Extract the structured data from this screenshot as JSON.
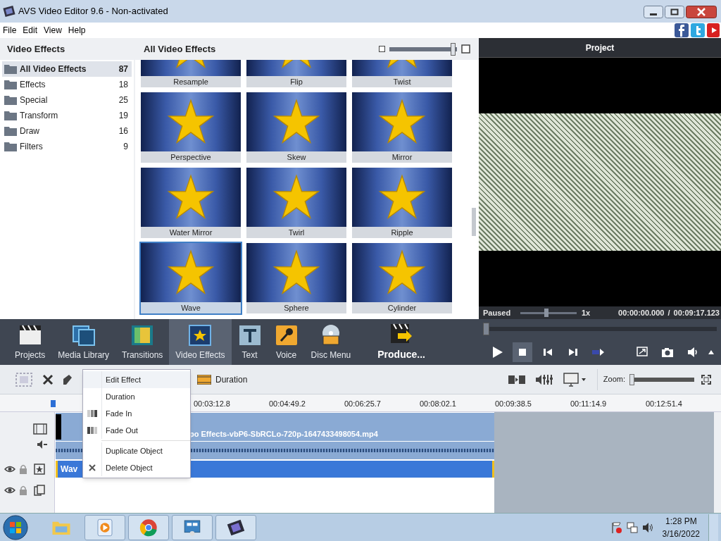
{
  "window": {
    "title": "AVS Video Editor 9.6 - Non-activated"
  },
  "menu": [
    "File",
    "Edit",
    "View",
    "Help"
  ],
  "categories_panel": {
    "title": "Video Effects",
    "items": [
      {
        "label": "All Video Effects",
        "count": "87",
        "selected": true
      },
      {
        "label": "Effects",
        "count": "18",
        "selected": false
      },
      {
        "label": "Special",
        "count": "25",
        "selected": false
      },
      {
        "label": "Transform",
        "count": "19",
        "selected": false
      },
      {
        "label": "Draw",
        "count": "16",
        "selected": false
      },
      {
        "label": "Filters",
        "count": "9",
        "selected": false
      }
    ]
  },
  "effects_panel": {
    "title": "All Video Effects",
    "size_slider": {
      "level": 0.95
    },
    "effects": [
      {
        "label": "Resample",
        "selected": false
      },
      {
        "label": "Flip",
        "selected": false
      },
      {
        "label": "Twist",
        "selected": false
      },
      {
        "label": "Perspective",
        "selected": false
      },
      {
        "label": "Skew",
        "selected": false
      },
      {
        "label": "Mirror",
        "selected": false
      },
      {
        "label": "Water Mirror",
        "selected": false
      },
      {
        "label": "Twirl",
        "selected": false
      },
      {
        "label": "Ripple",
        "selected": false
      },
      {
        "label": "Wave",
        "selected": true
      },
      {
        "label": "Sphere",
        "selected": false
      },
      {
        "label": "Cylinder",
        "selected": false
      }
    ]
  },
  "toolbar": [
    {
      "label": "Projects",
      "kind": "tab",
      "selected": false
    },
    {
      "label": "Media Library",
      "kind": "tab",
      "selected": false
    },
    {
      "label": "Transitions",
      "kind": "tab",
      "selected": false
    },
    {
      "label": "Video Effects",
      "kind": "tab",
      "selected": true
    },
    {
      "label": "Text",
      "kind": "tab",
      "selected": false
    },
    {
      "label": "Voice",
      "kind": "tab",
      "selected": false
    },
    {
      "label": "Disc Menu",
      "kind": "tab",
      "selected": false
    },
    {
      "label": "Produce...",
      "kind": "produce",
      "selected": false
    }
  ],
  "preview": {
    "title": "Project",
    "state": "Paused",
    "speed_slider": {
      "level": 0.46
    },
    "speed": "1x",
    "position": "00:00:00.000",
    "separator": "/",
    "duration": "00:09:17.123",
    "seek": {
      "level": 0
    }
  },
  "timeline_toolbar": {
    "duration_button": "Duration",
    "zoom_label": "Zoom:",
    "zoom": {
      "level": 0
    }
  },
  "context_menu": [
    {
      "label": "Edit Effect",
      "kind": "plain",
      "highlighted": true
    },
    {
      "label": "Duration",
      "kind": "plain",
      "highlighted": false
    },
    {
      "label": "Fade In",
      "kind": "fade-in",
      "highlighted": false
    },
    {
      "label": "Fade Out",
      "kind": "fade-out",
      "highlighted": false
    },
    {
      "label": "Duplicate Object",
      "kind": "plain",
      "highlighted": false
    },
    {
      "label": "Delete Object",
      "kind": "delete",
      "highlighted": false
    }
  ],
  "ruler": [
    "00:03:12.8",
    "00:04:49.2",
    "00:06:25.7",
    "00:08:02.1",
    "00:09:38.5",
    "00:11:14.9",
    "00:12:51.4"
  ],
  "tracks": {
    "video_clip": "po Effects-vbP6-SbRCLo-720p-1647433498054.mp4",
    "effect_clip": "Wav"
  },
  "taskbar": {
    "time": "1:28 PM",
    "date": "3/16/2022"
  }
}
